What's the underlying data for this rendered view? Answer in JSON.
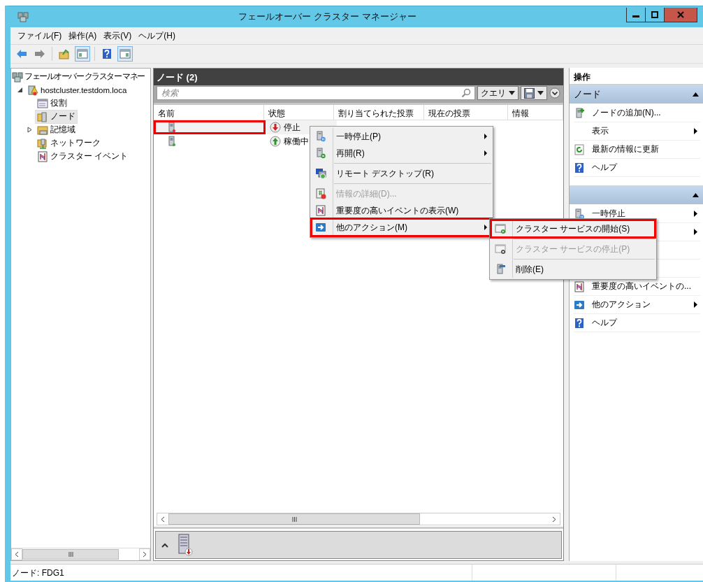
{
  "window": {
    "title": "フェールオーバー クラスター マネージャー"
  },
  "menu_bar": [
    "ファイル(F)",
    "操作(A)",
    "表示(V)",
    "ヘルプ(H)"
  ],
  "toolbar": [
    {
      "pressed": false
    },
    {
      "pressed": false
    },
    {
      "pressed": false
    },
    {
      "pressed": true
    },
    {
      "pressed": false
    },
    {
      "pressed": true
    }
  ],
  "tree": [
    {
      "label": "フェールオーバー クラスター マネー",
      "selected": false,
      "children": [
        {
          "label": "hostcluster.testdom.loca",
          "expanded": true,
          "selected": false,
          "children": [
            {
              "label": "役割",
              "selected": false
            },
            {
              "label": "ノード",
              "selected": true
            },
            {
              "label": "記憶域",
              "expanded": false,
              "selected": false
            },
            {
              "label": "ネットワーク",
              "selected": false
            },
            {
              "label": "クラスター イベント",
              "selected": false
            }
          ]
        }
      ]
    }
  ],
  "center": {
    "title": "ノード (2)",
    "search": {
      "placeholder": "検索"
    },
    "query_button": "クエリ",
    "columns": [
      "名前",
      "状態",
      "割り当てられた投票",
      "現在の投票",
      "情報"
    ],
    "rows": [
      {
        "status": "停止",
        "selected": true,
        "highlighted": true
      },
      {
        "status": "稼働中",
        "selected": false,
        "highlighted": false
      }
    ]
  },
  "context_menu": [
    {
      "kind": "item",
      "label": "一時停止(P)",
      "submenu": true,
      "disabled": false,
      "highlighted": false
    },
    {
      "kind": "item",
      "label": "再開(R)",
      "submenu": true,
      "disabled": false,
      "highlighted": false
    },
    {
      "kind": "separator"
    },
    {
      "kind": "item",
      "label": "リモート デスクトップ(R)",
      "submenu": false,
      "disabled": false,
      "highlighted": false
    },
    {
      "kind": "separator"
    },
    {
      "kind": "item",
      "label": "情報の詳細(D)...",
      "submenu": false,
      "disabled": true,
      "highlighted": false
    },
    {
      "kind": "item",
      "label": "重要度の高いイベントの表示(W)",
      "submenu": false,
      "disabled": false,
      "highlighted": false
    },
    {
      "kind": "item",
      "label": "他のアクション(M)",
      "submenu": true,
      "disabled": false,
      "highlighted": true
    }
  ],
  "submenu": [
    {
      "kind": "item",
      "label": "クラスター サービスの開始(S)",
      "disabled": false,
      "highlighted": true
    },
    {
      "kind": "separator"
    },
    {
      "kind": "item",
      "label": "クラスター サービスの停止(P)",
      "disabled": true,
      "highlighted": false
    },
    {
      "kind": "separator"
    },
    {
      "kind": "item",
      "label": "削除(E)",
      "disabled": false,
      "highlighted": false
    }
  ],
  "actions": {
    "title": "操作",
    "sections": [
      {
        "title": "ノード",
        "items": [
          {
            "label": "ノードの追加(N)...",
            "submenu": false
          },
          {
            "label": "表示",
            "submenu": true
          },
          {
            "label": "最新の情報に更新",
            "submenu": false
          },
          {
            "label": "ヘルプ",
            "submenu": false
          }
        ]
      },
      {
        "items": [
          {
            "label": "一時停止",
            "submenu": true
          },
          {
            "submenu": true
          },
          {
            "submenu": false
          },
          {
            "submenu": false
          },
          {
            "label": "重要度の高いイベントの...",
            "submenu": false
          },
          {
            "label": "他のアクション",
            "submenu": true
          },
          {
            "label": "ヘルプ",
            "submenu": false
          }
        ]
      }
    ]
  },
  "status_bar": "ノード:  FDG1"
}
